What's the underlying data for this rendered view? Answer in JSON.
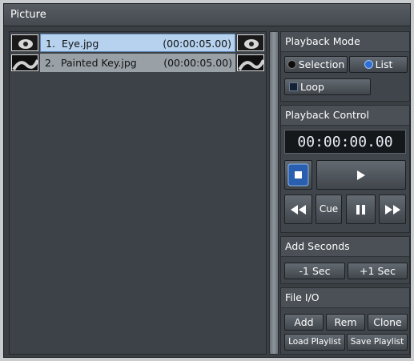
{
  "window": {
    "title": "Picture"
  },
  "playlist": [
    {
      "num": "1.",
      "name": "Eye.jpg",
      "duration": "(00:00:05.00)",
      "selected": true
    },
    {
      "num": "2.",
      "name": "Painted Key.jpg",
      "duration": "(00:00:05.00)",
      "selected": false
    }
  ],
  "playback_mode": {
    "header": "Playback Mode",
    "selection_label": "Selection",
    "list_label": "List",
    "loop_label": "Loop",
    "active": "List"
  },
  "playback_control": {
    "header": "Playback Control",
    "timecode": "00:00:00.00",
    "cue_label": "Cue"
  },
  "add_seconds": {
    "header": "Add Seconds",
    "minus_label": "-1 Sec",
    "plus_label": "+1 Sec"
  },
  "file_io": {
    "header": "File I/O",
    "add_label": "Add",
    "rem_label": "Rem",
    "clone_label": "Clone",
    "load_label": "Load Playlist",
    "save_label": "Save Playlist"
  },
  "colors": {
    "selected_row": "#b6d2ee",
    "radio_active": "#2f6fd4"
  }
}
